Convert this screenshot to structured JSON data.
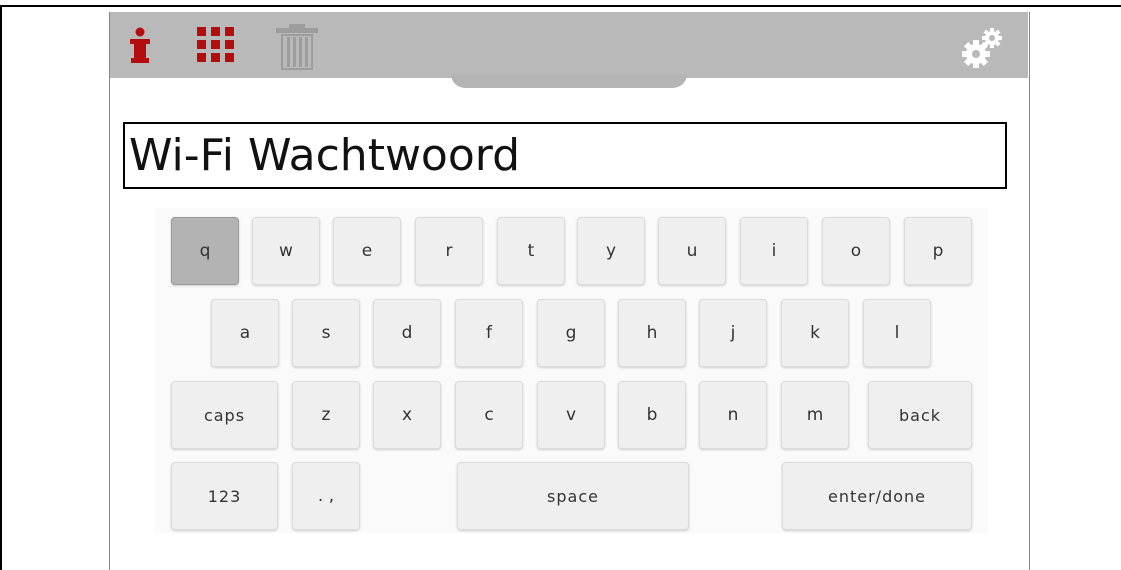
{
  "toolbar": {
    "icons": [
      "info-icon",
      "grid-menu-icon",
      "trash-icon",
      "settings-gears-icon"
    ],
    "accent_color": "#b30d0d",
    "disabled_color": "#9d9d9d",
    "bar_color": "#b9b9b9"
  },
  "input": {
    "value": "Wi-Fi Wachtwoord"
  },
  "keyboard": {
    "pressed_key": "q",
    "row1": [
      "q",
      "w",
      "e",
      "r",
      "t",
      "y",
      "u",
      "i",
      "o",
      "p"
    ],
    "row2": [
      "a",
      "s",
      "d",
      "f",
      "g",
      "h",
      "j",
      "k",
      "l"
    ],
    "row3": [
      "caps",
      "z",
      "x",
      "c",
      "v",
      "b",
      "n",
      "m",
      "back"
    ],
    "row4": [
      "123",
      ". ,",
      "space",
      "enter/done"
    ]
  }
}
